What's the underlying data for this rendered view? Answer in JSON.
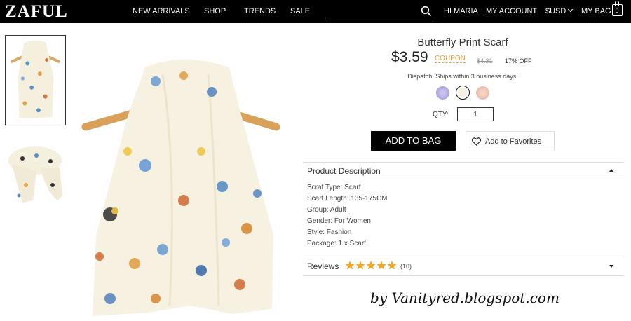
{
  "header": {
    "logo": "ZAFUL",
    "nav": [
      "NEW ARRIVALS",
      "SHOP",
      "TRENDS",
      "SALE"
    ],
    "search": {
      "value": "",
      "icon": "search-icon"
    },
    "greeting": "HI MARIA",
    "account": "MY ACCOUNT",
    "currency": "$USD",
    "bag": {
      "label": "MY BAG",
      "count": "0",
      "icon": "bag-icon"
    }
  },
  "product": {
    "title": "Butterfly Print Scarf",
    "price": "$3.59",
    "coupon": "COUPON",
    "old_price": "$4.31",
    "discount": "17% OFF",
    "dispatch": "Dispatch: Ships within 3 business days.",
    "colors": [
      "#b3afe3",
      "#f5f1df",
      "#edc0b2"
    ],
    "selected_color": 2,
    "qty_label": "QTY:",
    "qty_value": "1",
    "add_to_bag": "ADD TO BAG",
    "add_to_favorites": "Add to Favorites"
  },
  "description": {
    "title": "Product Description",
    "specs": [
      "Scraf Type: Scarf",
      "Scarf Length: 135-175CM",
      "Group: Adult",
      "Gender: For Women",
      "Style: Fashion",
      "Package: 1 x Scarf"
    ]
  },
  "reviews": {
    "title": "Reviews",
    "rating": 5,
    "rating_max": 5,
    "count": "(10)",
    "star_color": "#f5a623"
  },
  "watermark": "by Vanityred.blogspot.com"
}
